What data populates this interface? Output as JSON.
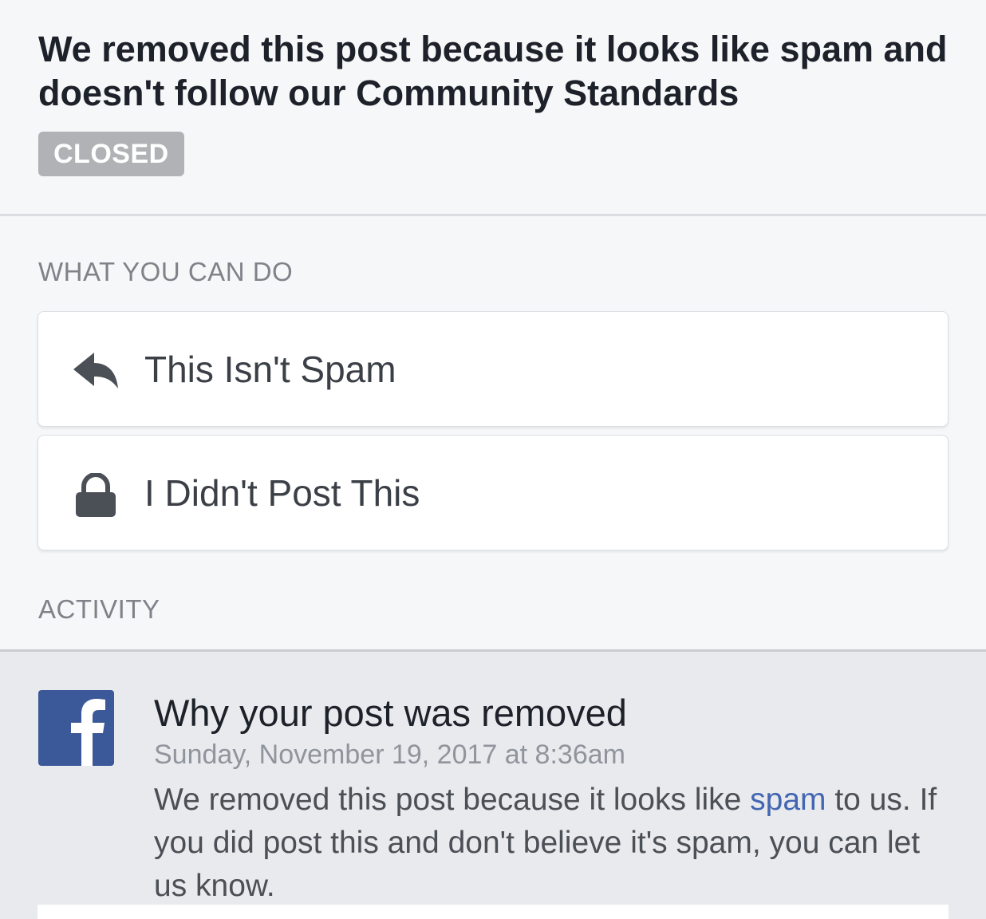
{
  "header": {
    "title": "We removed this post because it looks like spam and doesn't follow our Community Standards",
    "status_badge": "CLOSED"
  },
  "actions_section": {
    "label": "WHAT YOU CAN DO",
    "items": [
      {
        "label": "This Isn't Spam",
        "icon": "reply-arrow-icon"
      },
      {
        "label": "I Didn't Post This",
        "icon": "lock-icon"
      }
    ]
  },
  "activity_section": {
    "label": "ACTIVITY",
    "entry": {
      "icon": "facebook-logo",
      "title": "Why your post was removed",
      "timestamp": "Sunday, November 19, 2017 at 8:36am",
      "body_before_link": "We removed this post because it looks like ",
      "link_text": "spam",
      "body_after_link": " to us. If you did post this and don't believe it's spam, you can let us know."
    }
  },
  "colors": {
    "facebook_blue": "#3b5998",
    "link_blue": "#4267b2",
    "badge_gray": "#b0b2b5"
  }
}
